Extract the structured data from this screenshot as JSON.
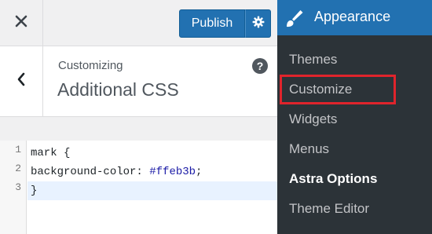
{
  "topbar": {
    "close_icon": "close-icon",
    "publish_label": "Publish",
    "gear_icon": "gear-icon",
    "accent_color": "#2271b1"
  },
  "section": {
    "back_icon": "chevron-left-icon",
    "customizing_label": "Customizing",
    "title": "Additional CSS",
    "help_label": "?"
  },
  "editor": {
    "lines": [
      {
        "num": "1",
        "selector": "mark",
        "rest": " {"
      },
      {
        "num": "2",
        "property": "background-color: ",
        "value": "#ffeb3b",
        "end": ";"
      },
      {
        "num": "3",
        "text": "}"
      }
    ]
  },
  "admin_menu": {
    "heading": "Appearance",
    "heading_icon": "paintbrush-icon",
    "items": [
      {
        "label": "Themes"
      },
      {
        "label": "Customize"
      },
      {
        "label": "Widgets"
      },
      {
        "label": "Menus"
      },
      {
        "label": "Astra Options"
      },
      {
        "label": "Theme Editor"
      }
    ],
    "highlight_color": "#e0242c"
  }
}
